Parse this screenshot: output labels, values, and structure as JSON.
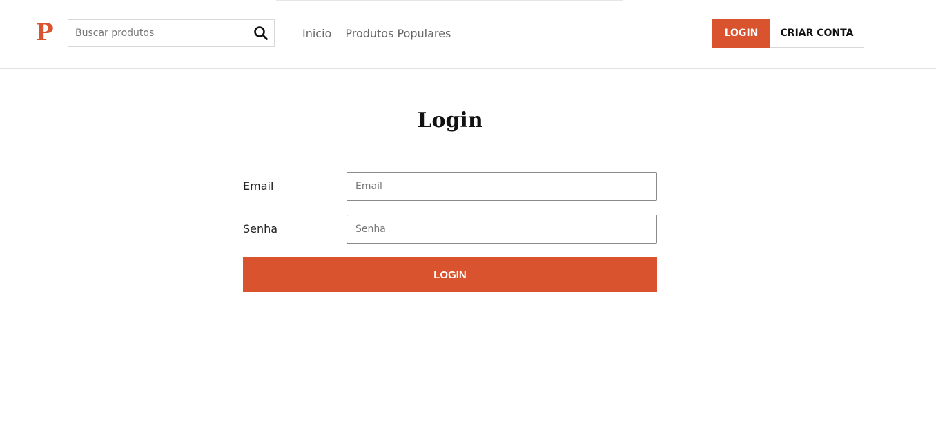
{
  "brand": {
    "logo_letter": "P",
    "accent_color": "#d9532f"
  },
  "search": {
    "placeholder": "Buscar produtos",
    "icon": "search-icon"
  },
  "nav": {
    "items": [
      {
        "label": "Inicio"
      },
      {
        "label": "Produtos Populares"
      }
    ]
  },
  "auth": {
    "login_label": "LOGIN",
    "signup_label": "CRIAR CONTA"
  },
  "page": {
    "title": "Login"
  },
  "form": {
    "email_label": "Email",
    "email_placeholder": "Email",
    "password_label": "Senha",
    "password_placeholder": "Senha",
    "submit_label": "LOGIN"
  }
}
